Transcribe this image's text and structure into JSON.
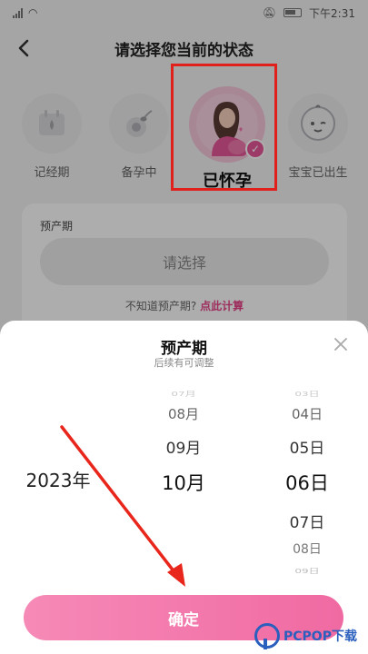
{
  "status_bar": {
    "time": "下午2:31"
  },
  "header": {
    "title": "请选择您当前的状态"
  },
  "states": [
    {
      "label": "记经期"
    },
    {
      "label": "备孕中"
    },
    {
      "label": "已怀孕",
      "selected": true
    },
    {
      "label": "宝宝已出生"
    }
  ],
  "card": {
    "label": "预产期",
    "select_label": "请选择",
    "unknown_prefix": "不知道预产期?",
    "unknown_link": "点此计算"
  },
  "sheet": {
    "title": "预产期",
    "subtitle": "后续有可调整",
    "year_selected": "2023年",
    "months": [
      "07月",
      "08月",
      "09月",
      "10月"
    ],
    "month_selected": "10月",
    "days": [
      "03日",
      "04日",
      "05日",
      "06日",
      "07日",
      "08日",
      "09日"
    ],
    "day_selected": "06日",
    "confirm_label": "确定"
  },
  "watermark": {
    "text": "PCPOP下载"
  },
  "colors": {
    "accent": "#f06aa2",
    "highlight_box": "#e0201a"
  }
}
